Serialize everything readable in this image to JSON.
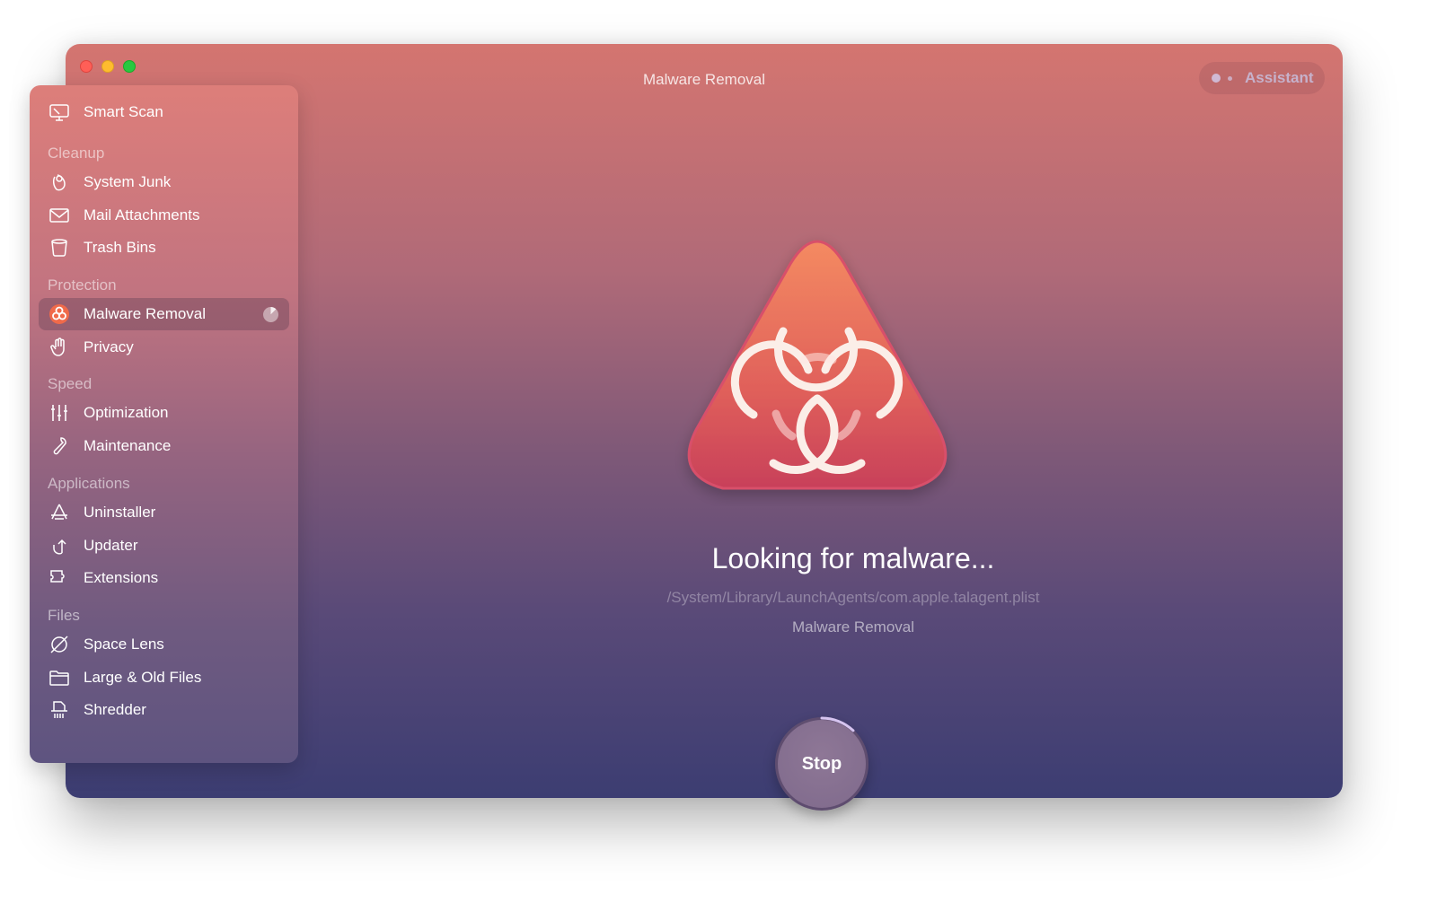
{
  "window": {
    "title": "Malware Removal",
    "traffic_lights": [
      "close",
      "minimize",
      "zoom"
    ]
  },
  "assistant": {
    "label": "Assistant"
  },
  "sidebar": {
    "top_item": {
      "label": "Smart Scan",
      "icon": "monitor-icon"
    },
    "sections": [
      {
        "heading": "Cleanup",
        "items": [
          {
            "label": "System Junk",
            "icon": "system-junk-icon"
          },
          {
            "label": "Mail Attachments",
            "icon": "envelope-icon"
          },
          {
            "label": "Trash Bins",
            "icon": "trash-bin-icon"
          }
        ]
      },
      {
        "heading": "Protection",
        "items": [
          {
            "label": "Malware Removal",
            "icon": "biohazard-icon",
            "active": true,
            "progress": 0.12
          },
          {
            "label": "Privacy",
            "icon": "hand-icon"
          }
        ]
      },
      {
        "heading": "Speed",
        "items": [
          {
            "label": "Optimization",
            "icon": "sliders-icon"
          },
          {
            "label": "Maintenance",
            "icon": "wrench-icon"
          }
        ]
      },
      {
        "heading": "Applications",
        "items": [
          {
            "label": "Uninstaller",
            "icon": "uninstaller-icon"
          },
          {
            "label": "Updater",
            "icon": "update-arrow-icon"
          },
          {
            "label": "Extensions",
            "icon": "puzzle-icon"
          }
        ]
      },
      {
        "heading": "Files",
        "items": [
          {
            "label": "Space Lens",
            "icon": "planet-icon"
          },
          {
            "label": "Large & Old Files",
            "icon": "folder-icon"
          },
          {
            "label": "Shredder",
            "icon": "shredder-icon"
          }
        ]
      }
    ]
  },
  "main": {
    "hero_icon": "biohazard-icon",
    "status_title": "Looking for malware...",
    "current_path": "/System/Library/LaunchAgents/com.apple.talagent.plist",
    "module_name": "Malware Removal",
    "stop_label": "Stop",
    "scan_progress": 0.12
  },
  "colors": {
    "top_gradient": "#d47570",
    "bottom_gradient": "#3c3d72",
    "hero_top": "#f48a62",
    "hero_bottom": "#c8405a"
  }
}
